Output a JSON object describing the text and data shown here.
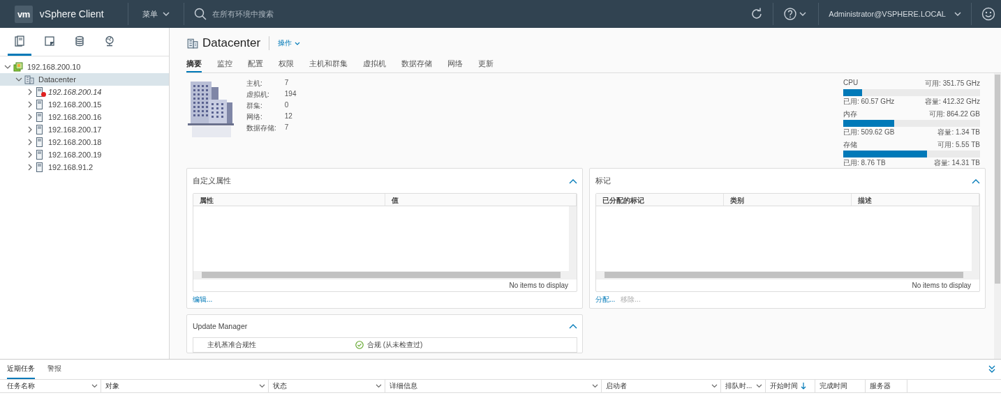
{
  "header": {
    "logo": "vm",
    "product": "vSphere Client",
    "menu": "菜单",
    "search_placeholder": "在所有环境中搜索",
    "user": "Administrator@VSPHERE.LOCAL"
  },
  "sidebar": {
    "view_tabs": [
      {
        "kind": "hosts",
        "selected": true
      },
      {
        "kind": "vms",
        "selected": false
      },
      {
        "kind": "storage",
        "selected": false
      },
      {
        "kind": "network",
        "selected": false
      }
    ],
    "tree": [
      {
        "label": "192.168.200.10",
        "kind": "vcenter",
        "expanded": true,
        "selected": false,
        "children": [
          {
            "label": "Datacenter",
            "kind": "datacenter",
            "expanded": true,
            "selected": true,
            "children": [
              {
                "label": "192.168.200.14",
                "kind": "host",
                "expanded": false,
                "selected": false,
                "alert": true
              },
              {
                "label": "192.168.200.15",
                "kind": "host",
                "expanded": false,
                "selected": false,
                "alert": false
              },
              {
                "label": "192.168.200.16",
                "kind": "host",
                "expanded": false,
                "selected": false,
                "alert": false
              },
              {
                "label": "192.168.200.17",
                "kind": "host",
                "expanded": false,
                "selected": false,
                "alert": false
              },
              {
                "label": "192.168.200.18",
                "kind": "host",
                "expanded": false,
                "selected": false,
                "alert": false
              },
              {
                "label": "192.168.200.19",
                "kind": "host",
                "expanded": false,
                "selected": false,
                "alert": false
              },
              {
                "label": "192.168.91.2",
                "kind": "host",
                "expanded": false,
                "selected": false,
                "alert": false
              }
            ]
          }
        ]
      }
    ]
  },
  "main": {
    "title": "Datacenter",
    "actions": "操作",
    "tabs": [
      {
        "label": "摘要",
        "selected": true
      },
      {
        "label": "监控",
        "selected": false
      },
      {
        "label": "配置",
        "selected": false
      },
      {
        "label": "权限",
        "selected": false
      },
      {
        "label": "主机和群集",
        "selected": false
      },
      {
        "label": "虚拟机",
        "selected": false
      },
      {
        "label": "数据存储",
        "selected": false
      },
      {
        "label": "网络",
        "selected": false
      },
      {
        "label": "更新",
        "selected": false
      }
    ],
    "stats": [
      {
        "label": "主机:",
        "value": "7"
      },
      {
        "label": "虚拟机:",
        "value": "194"
      },
      {
        "label": "群集:",
        "value": "0"
      },
      {
        "label": "网络:",
        "value": "12"
      },
      {
        "label": "数据存储:",
        "value": "7"
      }
    ],
    "resources": [
      {
        "name": "CPU",
        "free": "可用: 351.75 GHz",
        "level": 0.14,
        "used": "已用: 60.57 GHz",
        "capacity": "容量: 412.32 GHz"
      },
      {
        "name": "内存",
        "free": "可用: 864.22 GB",
        "level": 0.37,
        "used": "已用: 509.62 GB",
        "capacity": "容量: 1.34 TB"
      },
      {
        "name": "存储",
        "free": "可用: 5.55 TB",
        "level": 0.61,
        "used": "已用: 8.76 TB",
        "capacity": "容量: 14.31 TB"
      }
    ],
    "custom_attributes": {
      "title": "自定义属性",
      "expanded": true,
      "columns": [
        "属性",
        "值"
      ],
      "empty_text": "No items to display",
      "actions": [
        {
          "label": "编辑...",
          "disabled": false
        }
      ]
    },
    "tags": {
      "title": "标记",
      "expanded": true,
      "columns": [
        "已分配的标记",
        "类别",
        "描述"
      ],
      "empty_text": "No items to display",
      "actions": [
        {
          "label": "分配...",
          "disabled": false
        },
        {
          "label": "移除...",
          "disabled": true
        }
      ]
    },
    "update_manager": {
      "title": "Update Manager",
      "expanded": true,
      "rows": [
        {
          "label": "主机基准合规性",
          "status": "合规 (从未检查过)"
        }
      ]
    }
  },
  "tasks": {
    "tabs": [
      {
        "label": "近期任务",
        "selected": true
      },
      {
        "label": "警报",
        "selected": false
      }
    ],
    "columns": [
      {
        "label": "任务名称",
        "filter": true,
        "sorted": false
      },
      {
        "label": "对象",
        "filter": true,
        "sorted": false
      },
      {
        "label": "状态",
        "filter": true,
        "sorted": false
      },
      {
        "label": "详细信息",
        "filter": true,
        "sorted": false
      },
      {
        "label": "启动者",
        "filter": true,
        "sorted": false
      },
      {
        "label": "排队时...",
        "filter": true,
        "sorted": false
      },
      {
        "label": "开始时间",
        "filter": false,
        "sorted": true
      },
      {
        "label": "完成时间",
        "filter": false,
        "sorted": false
      },
      {
        "label": "服务器",
        "filter": false,
        "sorted": false
      }
    ]
  }
}
